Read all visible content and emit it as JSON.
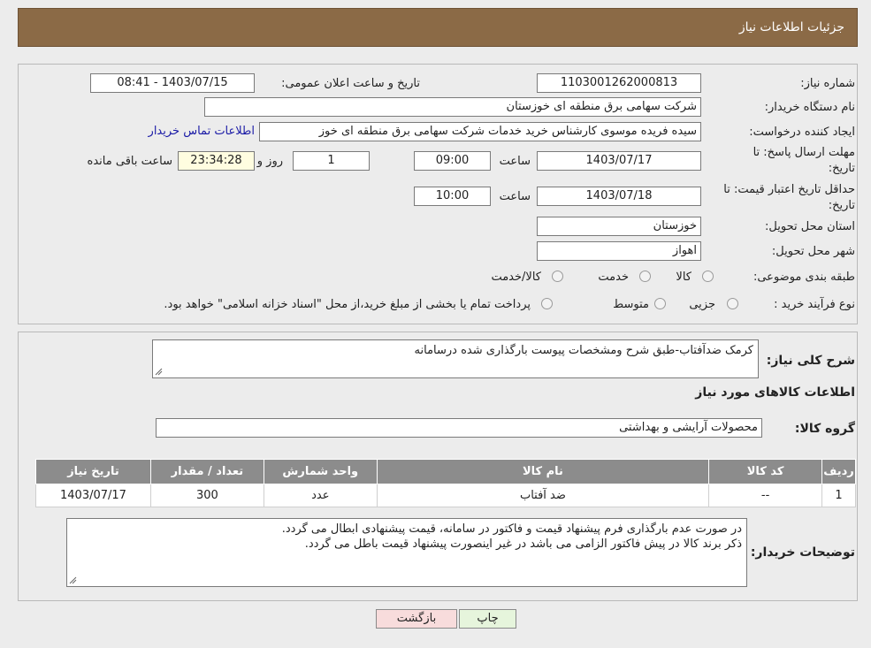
{
  "header": {
    "title": "جزئیات اطلاعات نیاز"
  },
  "form": {
    "need_number_label": "شماره نیاز:",
    "need_number": "1103001262000813",
    "announce_label": "تاریخ و ساعت اعلان عمومی:",
    "announce_value": "1403/07/15 - 08:41",
    "buyer_org_label": "نام دستگاه خریدار:",
    "buyer_org": "شرکت سهامی برق منطقه ای خوزستان",
    "creator_label": "ایجاد کننده درخواست:",
    "creator": "سیده فریده موسوی کارشناس خرید خدمات شرکت سهامی برق منطقه ای خوز",
    "contact_link": "اطلاعات تماس خریدار",
    "deadline_label_1": "مهلت ارسال پاسخ: تا",
    "deadline_label_2": "تاریخ:",
    "deadline_date": "1403/07/17",
    "time_label": "ساعت",
    "deadline_time": "09:00",
    "days_value": "1",
    "days_label": "روز و",
    "remaining_time": "23:34:28",
    "remaining_label": "ساعت باقی مانده",
    "validity_label_1": "حداقل تاریخ اعتبار قیمت: تا",
    "validity_label_2": "تاریخ:",
    "validity_date": "1403/07/18",
    "validity_time": "10:00",
    "province_label": "استان محل تحویل:",
    "province": "خوزستان",
    "city_label": "شهر محل تحویل:",
    "city": "اهواز",
    "category_label": "طبقه بندی موضوعی:",
    "category_options": [
      "کالا",
      "خدمت",
      "کالا/خدمت"
    ],
    "process_label": "نوع فرآیند خرید :",
    "process_options": [
      "جزیی",
      "متوسط"
    ],
    "process_note": "پرداخت تمام یا بخشی از مبلغ خرید،از محل \"اسناد خزانه اسلامی\" خواهد بود."
  },
  "summary": {
    "label": "شرح کلی نیاز:",
    "value": "کرمک ضدآفتاب-طبق شرح ومشخصات پیوست بارگذاری شده درسامانه",
    "items_title": "اطلاعات کالاهای مورد نیاز",
    "group_label": "گروه کالا:",
    "group_value": "محصولات آرایشی و بهداشتی"
  },
  "table": {
    "headers": [
      "ردیف",
      "کد کالا",
      "نام کالا",
      "واحد شمارش",
      "تعداد / مقدار",
      "تاریخ نیاز"
    ],
    "rows": [
      [
        "1",
        "--",
        "ضد آفتاب",
        "عدد",
        "300",
        "1403/07/17"
      ]
    ]
  },
  "notes": {
    "label": "توضیحات خریدار:",
    "line1": "در صورت عدم بارگذاری فرم پیشنهاد قیمت و فاکتور در سامانه، قیمت پیشنهادی ابطال می گردد.",
    "line2": "ذکر برند کالا در پیش فاکتور الزامی می باشد در غیر اینصورت پیشنهاد قیمت باطل می گردد."
  },
  "buttons": {
    "print": "چاپ",
    "back": "بازگشت"
  },
  "colors": {
    "header": "#8b6a46",
    "back_button": "#f8dcdc",
    "print_button": "#e6f5dc"
  }
}
